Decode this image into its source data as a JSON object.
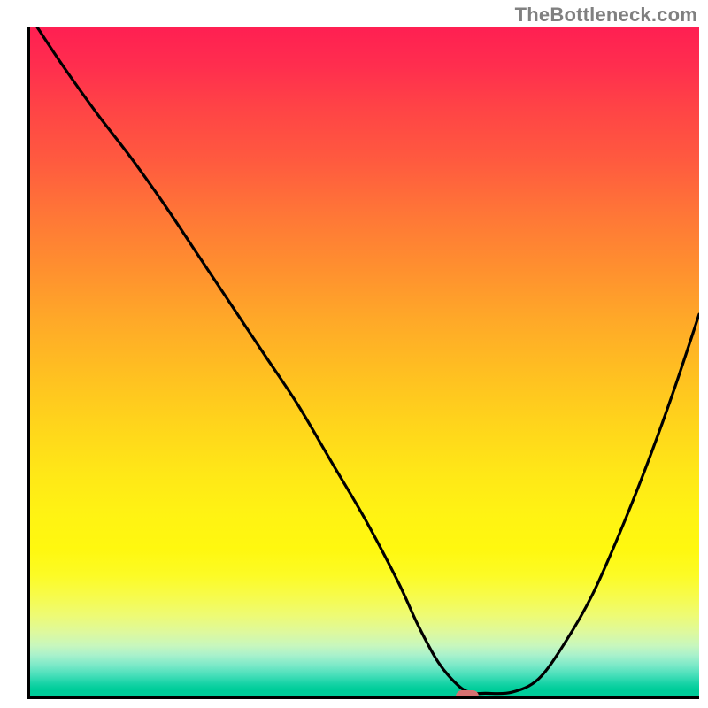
{
  "attribution": "TheBottleneck.com",
  "chart_data": {
    "type": "line",
    "title": "",
    "xlabel": "",
    "ylabel": "",
    "xlim": [
      0,
      100
    ],
    "ylim": [
      0,
      100
    ],
    "curve": {
      "x": [
        1,
        5,
        10,
        15,
        20,
        25,
        30,
        35,
        40,
        45,
        50,
        55,
        58,
        61,
        64,
        66,
        68,
        72,
        76,
        80,
        84,
        88,
        92,
        96,
        100
      ],
      "y": [
        100,
        94,
        87,
        80.5,
        73.5,
        66,
        58.5,
        51,
        43.5,
        35,
        26.5,
        17,
        10.5,
        5,
        1.5,
        0.4,
        0.35,
        0.5,
        2.5,
        8,
        15,
        24,
        34,
        45,
        57
      ]
    },
    "marker": {
      "x": 65,
      "y": 0.4
    },
    "background": "red-yellow-green vertical gradient",
    "axes": {
      "ticks": false,
      "grid": false
    }
  }
}
